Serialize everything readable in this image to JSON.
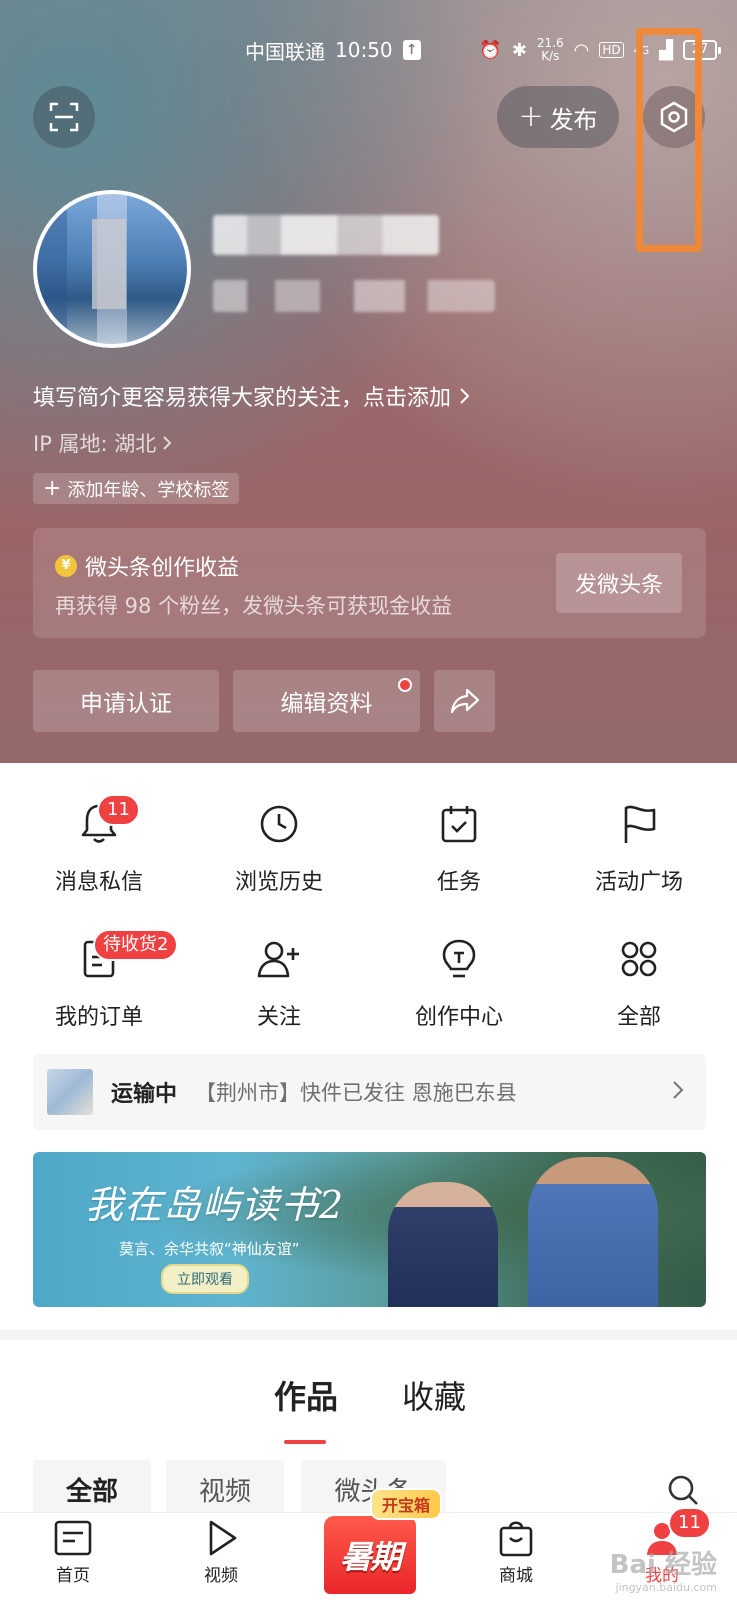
{
  "status_bar": {
    "carrier": "中国联通",
    "time": "10:50",
    "net_speed_value": "21.6",
    "net_speed_unit": "K/s",
    "signal_hd": "HD",
    "signal_type": "4G",
    "battery": "27"
  },
  "header": {
    "publish_label": "发布",
    "bio": "填写简介更容易获得大家的关注，点击添加",
    "ip_location": "IP 属地: 湖北",
    "add_tag": "添加年龄、学校标签",
    "earnings": {
      "coin": "¥",
      "title": "微头条创作收益",
      "desc": "再获得 98 个粉丝，发微头条可获现金收益",
      "button": "发微头条"
    },
    "actions": {
      "verify": "申请认证",
      "edit_profile": "编辑资料"
    }
  },
  "grid": {
    "messages": {
      "label": "消息私信",
      "badge": "11"
    },
    "history": {
      "label": "浏览历史"
    },
    "tasks": {
      "label": "任务"
    },
    "activity": {
      "label": "活动广场"
    },
    "orders": {
      "label": "我的订单",
      "badge": "待收货2"
    },
    "follow": {
      "label": "关注"
    },
    "creator": {
      "label": "创作中心"
    },
    "all": {
      "label": "全部"
    }
  },
  "shipping": {
    "status": "运输中",
    "detail": "【荆州市】快件已发往 恩施巴东县"
  },
  "banner": {
    "title": "我在岛屿读书2",
    "subtitle": "莫言、余华共叙“神仙友谊”",
    "cta": "立即观看"
  },
  "content_tabs": [
    "作品",
    "收藏"
  ],
  "filters": [
    "全部",
    "视频",
    "微头条"
  ],
  "bottom_nav": {
    "home": "首页",
    "video": "视频",
    "promo_tag": "开宝箱",
    "promo_label": "暑期",
    "mall": "商城",
    "mine": "我的",
    "mine_badge": "11"
  },
  "watermark": {
    "brand": "Bai 经验",
    "url": "jingyan.baidu.com"
  },
  "colors": {
    "accent": "#f04142",
    "highlight": "#f0883a"
  }
}
